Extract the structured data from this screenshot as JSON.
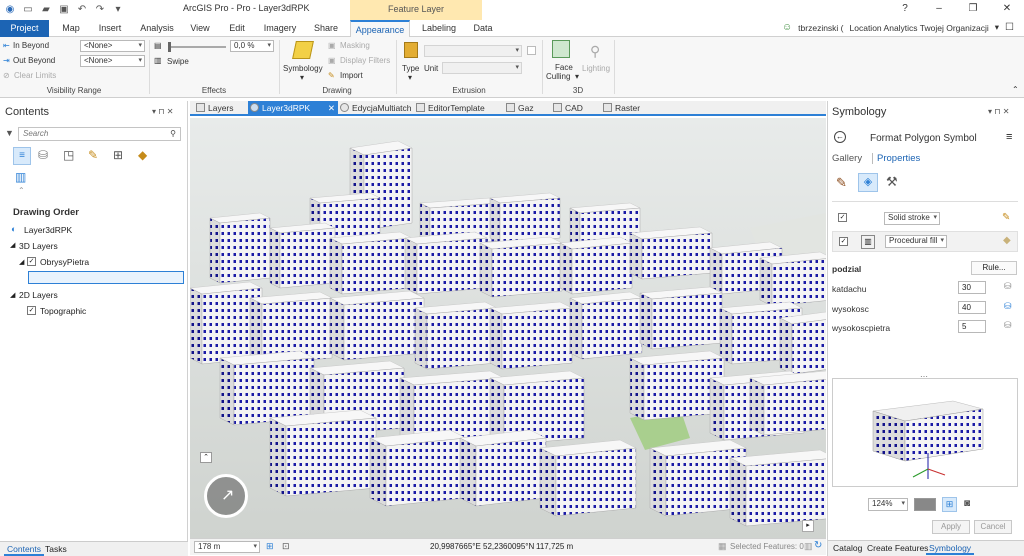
{
  "app": {
    "title": "ArcGIS Pro - Pro - Layer3dRPK",
    "context_tab_title": "Feature Layer",
    "user_name": "tbrzezinski (",
    "org_name": "Location Analytics Twojej Organizacji",
    "help": "?"
  },
  "ribbon": {
    "tabs": [
      "Project",
      "Map",
      "Insert",
      "Analysis",
      "View",
      "Edit",
      "Imagery",
      "Share",
      "Appearance",
      "Labeling",
      "Data"
    ],
    "active_tab": "Appearance",
    "visibility": {
      "in_beyond": "In Beyond",
      "out_beyond": "Out Beyond",
      "clear_limits": "Clear Limits",
      "in_value": "<None>",
      "out_value": "<None>",
      "group": "Visibility Range"
    },
    "effects": {
      "transparency": "0,0 %",
      "swipe": "Swipe",
      "group": "Effects"
    },
    "drawing": {
      "symbology": "Symbology",
      "masking": "Masking",
      "display_filters": "Display Filters",
      "import": "Import",
      "group": "Drawing"
    },
    "extrusion": {
      "type": "Type",
      "unit": "Unit",
      "group": "Extrusion"
    },
    "three_d": {
      "face_culling_1": "Face",
      "face_culling_2": "Culling",
      "lighting": "Lighting",
      "group": "3D"
    }
  },
  "contents": {
    "title": "Contents",
    "search_placeholder": "Search",
    "heading": "Drawing Order",
    "map_name": "Layer3dRPK",
    "group_3d": "3D Layers",
    "layer_1": "ObrysyPietra",
    "group_2d": "2D Layers",
    "layer_2": "Topographic",
    "bottom_tabs": [
      "Contents",
      "Tasks"
    ]
  },
  "map_tabs": [
    "Layers",
    "Layer3dRPK",
    "EdycjaMultiatch",
    "EditorTemplate",
    "Gaz",
    "CAD",
    "Raster"
  ],
  "active_map_tab": "Layer3dRPK",
  "status": {
    "scale": "178 m",
    "coords": "20,9987665°E 52,2360095°N",
    "elevation": "117,725 m",
    "selected": "Selected Features: 0"
  },
  "symbology": {
    "title": "Symbology",
    "panel_title": "Format Polygon Symbol",
    "tab_gallery": "Gallery",
    "tab_properties": "Properties",
    "layer_1": "Solid stroke",
    "layer_2": "Procedural fill",
    "section": "podzial",
    "rule_button": "Rule...",
    "params": [
      {
        "name": "katdachu",
        "value": "30"
      },
      {
        "name": "wysokosc",
        "value": "40"
      },
      {
        "name": "wysokoscpietra",
        "value": "5"
      }
    ],
    "zoom": "124%",
    "apply": "Apply",
    "cancel": "Cancel",
    "bottom_tabs": [
      "Catalog",
      "Create Features",
      "Symbology"
    ]
  },
  "colors": {
    "accent": "#2d80d6",
    "project_tab": "#1c64b4",
    "window_blue": "#1a1aa6"
  }
}
